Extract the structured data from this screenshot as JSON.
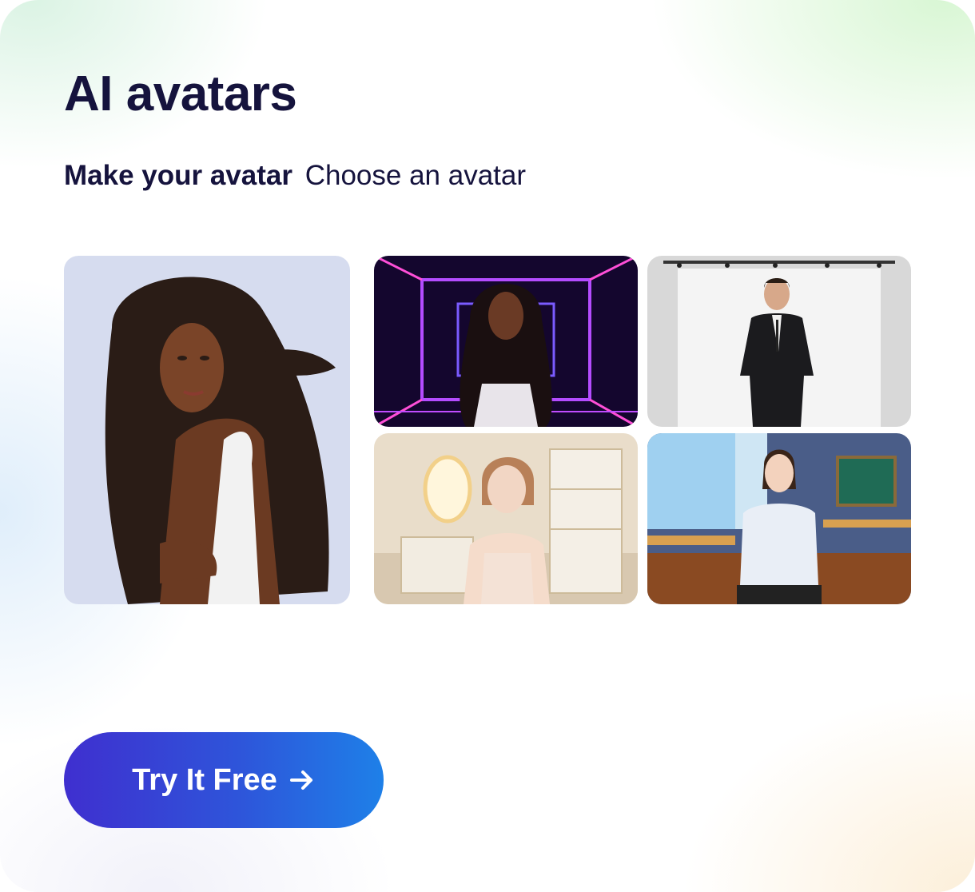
{
  "heading": {
    "title": "AI avatars"
  },
  "tabs": {
    "make_label": "Make your avatar",
    "choose_label": "Choose an avatar"
  },
  "gallery": {
    "tiles": [
      {
        "name": "avatar-woman-long-curly-hair",
        "scene": "plain lavender background"
      },
      {
        "name": "avatar-woman-neon-tunnel",
        "scene": "purple neon corridor"
      },
      {
        "name": "avatar-man-black-suit",
        "scene": "white photo studio"
      },
      {
        "name": "avatar-woman-vanity-room",
        "scene": "beige vanity room"
      },
      {
        "name": "avatar-woman-classroom",
        "scene": "classroom"
      }
    ]
  },
  "cta": {
    "label": "Try It Free",
    "icon": "arrow-right-icon"
  },
  "colors": {
    "text": "#15133d",
    "cta_start": "#3f2fcf",
    "cta_end": "#1e80e8"
  }
}
